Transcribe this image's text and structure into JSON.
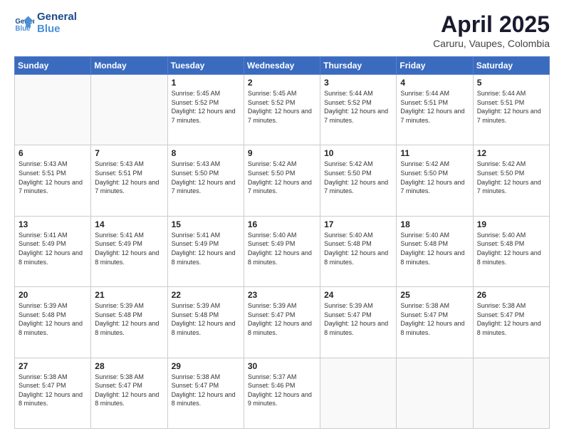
{
  "logo": {
    "line1": "General",
    "line2": "Blue"
  },
  "header": {
    "month_year": "April 2025",
    "location": "Caruru, Vaupes, Colombia"
  },
  "weekdays": [
    "Sunday",
    "Monday",
    "Tuesday",
    "Wednesday",
    "Thursday",
    "Friday",
    "Saturday"
  ],
  "weeks": [
    [
      {
        "day": "",
        "info": ""
      },
      {
        "day": "",
        "info": ""
      },
      {
        "day": "1",
        "info": "Sunrise: 5:45 AM\nSunset: 5:52 PM\nDaylight: 12 hours and 7 minutes."
      },
      {
        "day": "2",
        "info": "Sunrise: 5:45 AM\nSunset: 5:52 PM\nDaylight: 12 hours and 7 minutes."
      },
      {
        "day": "3",
        "info": "Sunrise: 5:44 AM\nSunset: 5:52 PM\nDaylight: 12 hours and 7 minutes."
      },
      {
        "day": "4",
        "info": "Sunrise: 5:44 AM\nSunset: 5:51 PM\nDaylight: 12 hours and 7 minutes."
      },
      {
        "day": "5",
        "info": "Sunrise: 5:44 AM\nSunset: 5:51 PM\nDaylight: 12 hours and 7 minutes."
      }
    ],
    [
      {
        "day": "6",
        "info": "Sunrise: 5:43 AM\nSunset: 5:51 PM\nDaylight: 12 hours and 7 minutes."
      },
      {
        "day": "7",
        "info": "Sunrise: 5:43 AM\nSunset: 5:51 PM\nDaylight: 12 hours and 7 minutes."
      },
      {
        "day": "8",
        "info": "Sunrise: 5:43 AM\nSunset: 5:50 PM\nDaylight: 12 hours and 7 minutes."
      },
      {
        "day": "9",
        "info": "Sunrise: 5:42 AM\nSunset: 5:50 PM\nDaylight: 12 hours and 7 minutes."
      },
      {
        "day": "10",
        "info": "Sunrise: 5:42 AM\nSunset: 5:50 PM\nDaylight: 12 hours and 7 minutes."
      },
      {
        "day": "11",
        "info": "Sunrise: 5:42 AM\nSunset: 5:50 PM\nDaylight: 12 hours and 7 minutes."
      },
      {
        "day": "12",
        "info": "Sunrise: 5:42 AM\nSunset: 5:50 PM\nDaylight: 12 hours and 7 minutes."
      }
    ],
    [
      {
        "day": "13",
        "info": "Sunrise: 5:41 AM\nSunset: 5:49 PM\nDaylight: 12 hours and 8 minutes."
      },
      {
        "day": "14",
        "info": "Sunrise: 5:41 AM\nSunset: 5:49 PM\nDaylight: 12 hours and 8 minutes."
      },
      {
        "day": "15",
        "info": "Sunrise: 5:41 AM\nSunset: 5:49 PM\nDaylight: 12 hours and 8 minutes."
      },
      {
        "day": "16",
        "info": "Sunrise: 5:40 AM\nSunset: 5:49 PM\nDaylight: 12 hours and 8 minutes."
      },
      {
        "day": "17",
        "info": "Sunrise: 5:40 AM\nSunset: 5:48 PM\nDaylight: 12 hours and 8 minutes."
      },
      {
        "day": "18",
        "info": "Sunrise: 5:40 AM\nSunset: 5:48 PM\nDaylight: 12 hours and 8 minutes."
      },
      {
        "day": "19",
        "info": "Sunrise: 5:40 AM\nSunset: 5:48 PM\nDaylight: 12 hours and 8 minutes."
      }
    ],
    [
      {
        "day": "20",
        "info": "Sunrise: 5:39 AM\nSunset: 5:48 PM\nDaylight: 12 hours and 8 minutes."
      },
      {
        "day": "21",
        "info": "Sunrise: 5:39 AM\nSunset: 5:48 PM\nDaylight: 12 hours and 8 minutes."
      },
      {
        "day": "22",
        "info": "Sunrise: 5:39 AM\nSunset: 5:48 PM\nDaylight: 12 hours and 8 minutes."
      },
      {
        "day": "23",
        "info": "Sunrise: 5:39 AM\nSunset: 5:47 PM\nDaylight: 12 hours and 8 minutes."
      },
      {
        "day": "24",
        "info": "Sunrise: 5:39 AM\nSunset: 5:47 PM\nDaylight: 12 hours and 8 minutes."
      },
      {
        "day": "25",
        "info": "Sunrise: 5:38 AM\nSunset: 5:47 PM\nDaylight: 12 hours and 8 minutes."
      },
      {
        "day": "26",
        "info": "Sunrise: 5:38 AM\nSunset: 5:47 PM\nDaylight: 12 hours and 8 minutes."
      }
    ],
    [
      {
        "day": "27",
        "info": "Sunrise: 5:38 AM\nSunset: 5:47 PM\nDaylight: 12 hours and 8 minutes."
      },
      {
        "day": "28",
        "info": "Sunrise: 5:38 AM\nSunset: 5:47 PM\nDaylight: 12 hours and 8 minutes."
      },
      {
        "day": "29",
        "info": "Sunrise: 5:38 AM\nSunset: 5:47 PM\nDaylight: 12 hours and 8 minutes."
      },
      {
        "day": "30",
        "info": "Sunrise: 5:37 AM\nSunset: 5:46 PM\nDaylight: 12 hours and 9 minutes."
      },
      {
        "day": "",
        "info": ""
      },
      {
        "day": "",
        "info": ""
      },
      {
        "day": "",
        "info": ""
      }
    ]
  ]
}
